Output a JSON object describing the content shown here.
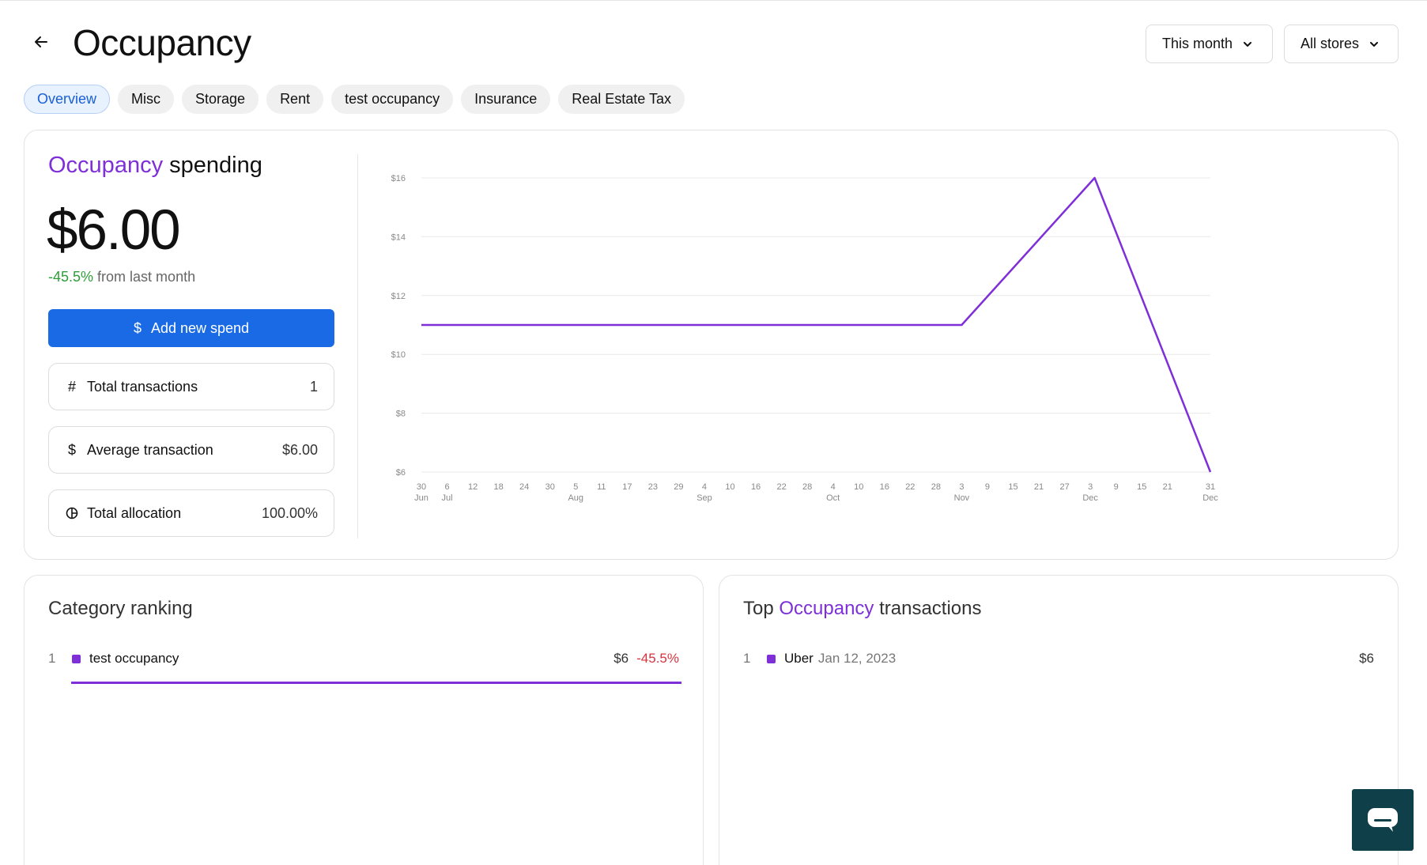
{
  "header": {
    "title": "Occupancy",
    "period_dropdown": "This month",
    "store_dropdown": "All stores"
  },
  "tabs": [
    {
      "label": "Overview",
      "active": true
    },
    {
      "label": "Misc"
    },
    {
      "label": "Storage"
    },
    {
      "label": "Rent"
    },
    {
      "label": "test occupancy"
    },
    {
      "label": "Insurance"
    },
    {
      "label": "Real Estate Tax"
    }
  ],
  "summary": {
    "title_accent": "Occupancy",
    "title_rest": " spending",
    "amount": "$6.00",
    "change_value": "-45.5%",
    "change_text": " from last month",
    "add_button": "Add new spend",
    "stats": [
      {
        "icon": "hash-icon",
        "label": "Total transactions",
        "value": "1"
      },
      {
        "icon": "dollar-icon",
        "label": "Average transaction",
        "value": "$6.00"
      },
      {
        "icon": "pie-icon",
        "label": "Total allocation",
        "value": "100.00%"
      }
    ]
  },
  "chart_data": {
    "type": "line",
    "title": "",
    "xlabel": "",
    "ylabel": "",
    "ylim": [
      6,
      16
    ],
    "y_ticks": [
      "$6",
      "$8",
      "$10",
      "$12",
      "$14",
      "$16"
    ],
    "x_ticks": [
      {
        "day": "30",
        "month": "Jun"
      },
      {
        "day": "6",
        "month": "Jul"
      },
      {
        "day": "12",
        "month": ""
      },
      {
        "day": "18",
        "month": ""
      },
      {
        "day": "24",
        "month": ""
      },
      {
        "day": "30",
        "month": ""
      },
      {
        "day": "5",
        "month": "Aug"
      },
      {
        "day": "11",
        "month": ""
      },
      {
        "day": "17",
        "month": ""
      },
      {
        "day": "23",
        "month": ""
      },
      {
        "day": "29",
        "month": ""
      },
      {
        "day": "4",
        "month": "Sep"
      },
      {
        "day": "10",
        "month": ""
      },
      {
        "day": "16",
        "month": ""
      },
      {
        "day": "22",
        "month": ""
      },
      {
        "day": "28",
        "month": ""
      },
      {
        "day": "4",
        "month": "Oct"
      },
      {
        "day": "10",
        "month": ""
      },
      {
        "day": "16",
        "month": ""
      },
      {
        "day": "22",
        "month": ""
      },
      {
        "day": "28",
        "month": ""
      },
      {
        "day": "3",
        "month": "Nov"
      },
      {
        "day": "9",
        "month": ""
      },
      {
        "day": "15",
        "month": ""
      },
      {
        "day": "21",
        "month": ""
      },
      {
        "day": "27",
        "month": ""
      },
      {
        "day": "3",
        "month": "Dec"
      },
      {
        "day": "9",
        "month": ""
      },
      {
        "day": "15",
        "month": ""
      },
      {
        "day": "21",
        "month": ""
      },
      {
        "day": "31",
        "month": "Dec"
      }
    ],
    "series": [
      {
        "color": "#7e2fd8",
        "points": [
          {
            "x": "2022-06-30",
            "y": 11
          },
          {
            "x": "2022-11-03",
            "y": 11
          },
          {
            "x": "2022-12-04",
            "y": 16
          },
          {
            "x": "2022-12-31",
            "y": 6
          }
        ]
      }
    ],
    "grid": true
  },
  "ranking": {
    "title": "Category ranking",
    "items": [
      {
        "rank": "1",
        "name": "test occupancy",
        "amount": "$6",
        "change": "-45.5%",
        "share": 1.0
      }
    ]
  },
  "top_transactions": {
    "title_prefix": "Top ",
    "title_accent": "Occupancy",
    "title_suffix": " transactions",
    "items": [
      {
        "rank": "1",
        "merchant": "Uber",
        "date": "Jan 12, 2023",
        "amount": "$6"
      }
    ]
  },
  "colors": {
    "accent": "#7e2fd8",
    "primary_button": "#1a6ae6",
    "positive": "#2f9e3a",
    "negative": "#d7343f",
    "chat_button": "#0f3f48"
  }
}
